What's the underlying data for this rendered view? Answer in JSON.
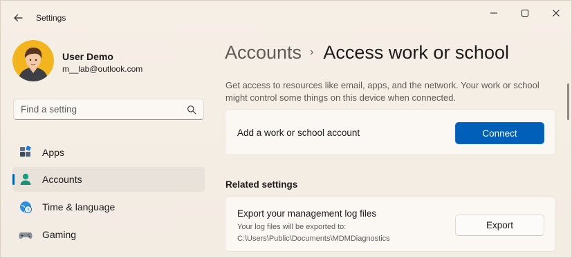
{
  "window": {
    "title": "Settings"
  },
  "user": {
    "name": "User Demo",
    "email": "m__lab@outlook.com"
  },
  "search": {
    "placeholder": "Find a setting"
  },
  "nav": {
    "items": [
      {
        "label": "Apps",
        "icon": "apps-icon",
        "active": false
      },
      {
        "label": "Accounts",
        "icon": "accounts-icon",
        "active": true
      },
      {
        "label": "Time & language",
        "icon": "time-language-icon",
        "active": false
      },
      {
        "label": "Gaming",
        "icon": "gaming-icon",
        "active": false
      }
    ]
  },
  "breadcrumb": {
    "parent": "Accounts",
    "separator": "›",
    "current": "Access work or school"
  },
  "main": {
    "description": "Get access to resources like email, apps, and the network. Your work or school might control some things on this device when connected.",
    "connect_card": {
      "label": "Add a work or school account",
      "button": "Connect"
    },
    "related_title": "Related settings",
    "export_card": {
      "title": "Export your management log files",
      "subtitle": "Your log files will be exported to: C:\\Users\\Public\\Documents\\MDMDiagnostics",
      "button": "Export"
    }
  },
  "colors": {
    "accent": "#005fb8",
    "background": "#f3ece4",
    "card": "#fbf8f4"
  }
}
